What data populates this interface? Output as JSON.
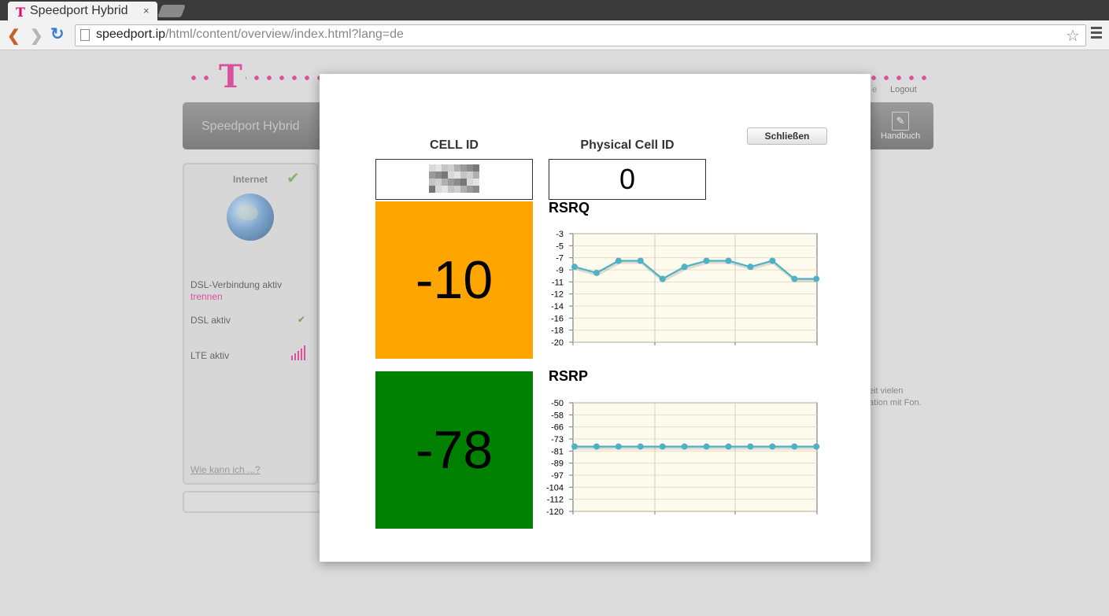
{
  "browser": {
    "tab_title": "Speedport Hybrid",
    "tab_close": "×",
    "url_host": "speedport.ip",
    "url_path": "/html/content/overview/index.html?lang=de"
  },
  "header": {
    "logo": "T",
    "nav_title": "Speedport Hybrid",
    "handbuch_label": "Handbuch",
    "logout_label": "Logout",
    "logout_prev_fragment": "e"
  },
  "sidebar": {
    "internet_label": "Internet",
    "dsl_connection": "DSL-Verbindung aktiv",
    "disconnect": "trennen",
    "dsl_active": "DSL aktiv",
    "lte_active": "LTE aktiv",
    "help_link": "Wie kann ich ...?"
  },
  "background_text": {
    "line1": "eit vielen",
    "line2": "ation mit Fon."
  },
  "modal": {
    "close_label": "Schließen",
    "cell_id_label": "CELL ID",
    "physical_cell_id_label": "Physical Cell ID",
    "physical_cell_id_value": "0",
    "rsrq": {
      "title": "RSRQ",
      "value": "-10",
      "color": "#ffa500"
    },
    "rsrp": {
      "title": "RSRP",
      "value": "-78",
      "color": "#008000"
    }
  },
  "chart_data": [
    {
      "type": "line",
      "title": "RSRQ",
      "yticks": [
        -3,
        -5,
        -7,
        -9,
        -11,
        -12,
        -14,
        -16,
        -18,
        -20
      ],
      "ylim": [
        -3,
        -20
      ],
      "x": [
        0,
        1,
        2,
        3,
        4,
        5,
        6,
        7,
        8,
        9,
        10,
        11
      ],
      "values": [
        -8.5,
        -9.5,
        -7.5,
        -7.5,
        -10.5,
        -8.5,
        -7.5,
        -7.5,
        -8.5,
        -7.5,
        -10.5,
        -10.5
      ],
      "line_color": "#4fb0c6",
      "grid": true
    },
    {
      "type": "line",
      "title": "RSRP",
      "yticks": [
        -50,
        -58,
        -66,
        -73,
        -81,
        -89,
        -97,
        -104,
        -112,
        -120
      ],
      "ylim": [
        -50,
        -120
      ],
      "x": [
        0,
        1,
        2,
        3,
        4,
        5,
        6,
        7,
        8,
        9,
        10,
        11
      ],
      "values": [
        -78,
        -78,
        -78,
        -78,
        -78,
        -78,
        -78,
        -78,
        -78,
        -78,
        -78,
        -78
      ],
      "line_color": "#4fb0c6",
      "grid": true
    }
  ]
}
